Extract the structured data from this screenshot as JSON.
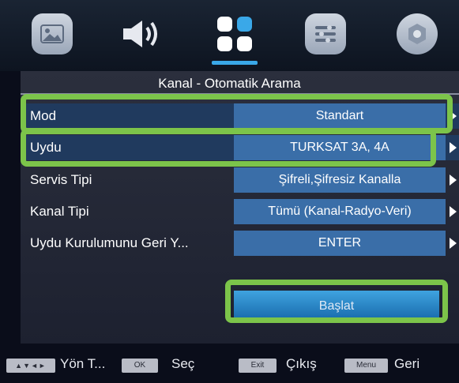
{
  "panel_title": "Kanal - Otomatik Arama",
  "tabs": [
    {
      "icon": "picture-icon"
    },
    {
      "icon": "sound-icon"
    },
    {
      "icon": "channel-icon"
    },
    {
      "icon": "settings-icon"
    },
    {
      "icon": "options-icon"
    }
  ],
  "rows": [
    {
      "label": "Mod",
      "value": "Standart"
    },
    {
      "label": "Uydu",
      "value": "TURKSAT 3A, 4A"
    },
    {
      "label": "Servis Tipi",
      "value": "Şifreli,Şifresiz Kanalla"
    },
    {
      "label": "Kanal Tipi",
      "value": "Tümü (Kanal-Radyo-Veri)"
    },
    {
      "label": "Uydu Kurulumunu Geri Y...",
      "value": "ENTER"
    }
  ],
  "start_label": "Başlat",
  "footer": {
    "nav_key": "▲▼◄►",
    "nav_label": "Yön T...",
    "ok_key": "OK",
    "ok_label": "Seç",
    "exit_key": "Exit",
    "exit_label": "Çıkış",
    "menu_key": "Menu",
    "menu_label": "Geri"
  },
  "colors": {
    "highlight": "#7cc44a",
    "value_box": "#3a6ea8",
    "start_button": "#3fa3e0",
    "active_tab": "#3aa8e8"
  }
}
